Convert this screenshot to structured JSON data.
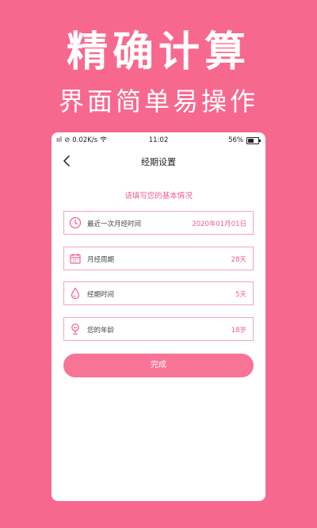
{
  "promo": {
    "headline": "精确计算",
    "subline": "界面简单易操作"
  },
  "status": {
    "left": "0.02K/s",
    "signal": "ııl",
    "time": "11:02",
    "battery": "56%"
  },
  "nav": {
    "title": "经期设置"
  },
  "form": {
    "prompt": "请填写您的基本情况",
    "fields": [
      {
        "label": "最近一次月经时间",
        "value": "2020年01月01日",
        "icon": "clock-icon"
      },
      {
        "label": "月经周期",
        "value": "28天",
        "icon": "calendar-icon"
      },
      {
        "label": "经期时间",
        "value": "5天",
        "icon": "drop-icon"
      },
      {
        "label": "您的年龄",
        "value": "18岁",
        "icon": "age-icon"
      }
    ],
    "submit": "完成"
  },
  "colors": {
    "background": "#f7688f",
    "accent": "#f0608a",
    "field_border": "#f7a3bb",
    "button": "#f87497"
  }
}
